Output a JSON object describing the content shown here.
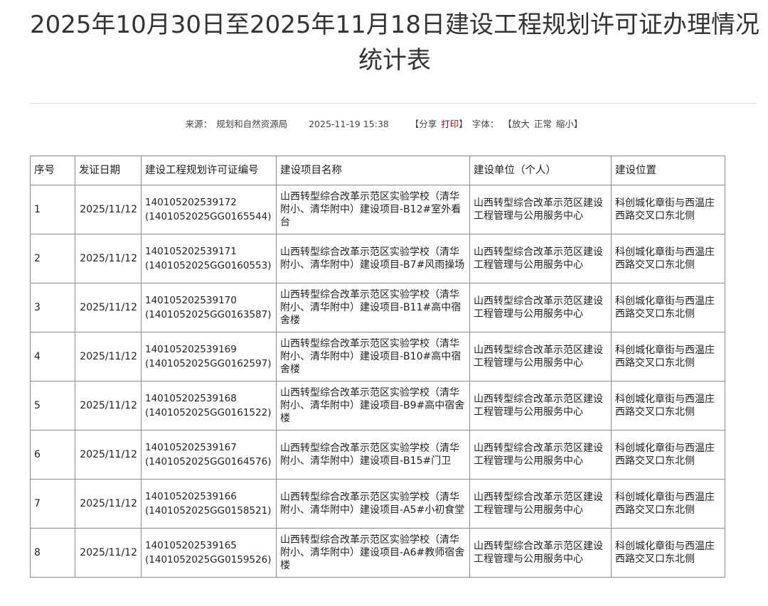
{
  "title": "2025年10月30日至2025年11月18日建设工程规划许可证办理情况统计表",
  "meta": {
    "source_label": "来源：",
    "source": "规划和自然资源局",
    "datetime": "2025-11-19 15:38",
    "bracket_open": "【",
    "share": "分享",
    "print": "打印",
    "bracket_close": "】",
    "font_label": "字体：",
    "font_open": "【",
    "font_larger": "放大",
    "font_normal": "正常",
    "font_smaller": "缩小",
    "font_close": "】"
  },
  "table": {
    "headers": [
      "序号",
      "发证日期",
      "建设工程规划许可证编号",
      "建设项目名称",
      "建设单位（个人）",
      "建设位置"
    ],
    "rows": [
      {
        "seq": "1",
        "date": "2025/11/12",
        "permit_no": "140105202539172",
        "permit_no2": "(1401052025GG0165544)",
        "project": "山西转型综合改革示范区实验学校（清华附小、清华附中）建设项目-B12#室外看台",
        "unit": "山西转型综合改革示范区建设工程管理与公用服务中心",
        "location": "科创城化章街与西温庄西路交叉口东北侧"
      },
      {
        "seq": "2",
        "date": "2025/11/12",
        "permit_no": "140105202539171",
        "permit_no2": "(1401052025GG0160553)",
        "project": "山西转型综合改革示范区实验学校（清华附小、清华附中）建设项目-B7#风雨操场",
        "unit": "山西转型综合改革示范区建设工程管理与公用服务中心",
        "location": "科创城化章街与西温庄西路交叉口东北侧"
      },
      {
        "seq": "3",
        "date": "2025/11/12",
        "permit_no": "140105202539170",
        "permit_no2": "(1401052025GG0163587)",
        "project": "山西转型综合改革示范区实验学校（清华附小、清华附中）建设项目-B11#高中宿舍楼",
        "unit": "山西转型综合改革示范区建设工程管理与公用服务中心",
        "location": "科创城化章街与西温庄西路交叉口东北侧"
      },
      {
        "seq": "4",
        "date": "2025/11/12",
        "permit_no": "140105202539169",
        "permit_no2": "(1401052025GG0162597)",
        "project": "山西转型综合改革示范区实验学校（清华附小、清华附中）建设项目-B10#高中宿舍楼",
        "unit": "山西转型综合改革示范区建设工程管理与公用服务中心",
        "location": "科创城化章街与西温庄西路交叉口东北侧"
      },
      {
        "seq": "5",
        "date": "2025/11/12",
        "permit_no": "140105202539168",
        "permit_no2": "(1401052025GG0161522)",
        "project": "山西转型综合改革示范区实验学校（清华附小、清华附中）建设项目-B9#高中宿舍楼",
        "unit": "山西转型综合改革示范区建设工程管理与公用服务中心",
        "location": "科创城化章街与西温庄西路交叉口东北侧"
      },
      {
        "seq": "6",
        "date": "2025/11/12",
        "permit_no": "140105202539167",
        "permit_no2": "(1401052025GG0164576)",
        "project": "山西转型综合改革示范区实验学校（清华附小、清华附中）建设项目-B15#门卫",
        "unit": "山西转型综合改革示范区建设工程管理与公用服务中心",
        "location": "科创城化章街与西温庄西路交叉口东北侧"
      },
      {
        "seq": "7",
        "date": "2025/11/12",
        "permit_no": "140105202539166",
        "permit_no2": "(1401052025GG0158521)",
        "project": "山西转型综合改革示范区实验学校（清华附小、清华附中）建设项目-A5#小初食堂",
        "unit": "山西转型综合改革示范区建设工程管理与公用服务中心",
        "location": "科创城化章街与西温庄西路交叉口东北侧"
      },
      {
        "seq": "8",
        "date": "2025/11/12",
        "permit_no": "140105202539165",
        "permit_no2": "(1401052025GG0159526)",
        "project": "山西转型综合改革示范区实验学校（清华附小、清华附中）建设项目-A6#教师宿舍楼",
        "unit": "山西转型综合改革示范区建设工程管理与公用服务中心",
        "location": "科创城化章街与西温庄西路交叉口东北侧"
      }
    ]
  },
  "colors": {
    "text": "#222222",
    "print_link": "#c00000",
    "border": "#8c8c8c",
    "divider": "#dcdcdc"
  }
}
